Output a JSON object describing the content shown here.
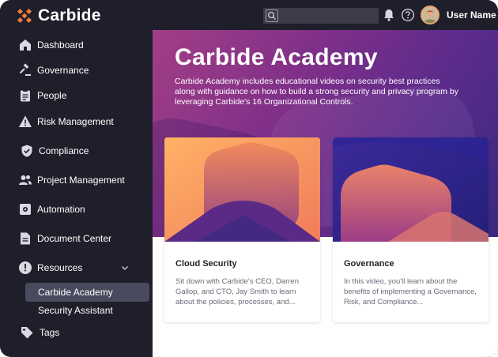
{
  "app": {
    "name": "Carbide",
    "brand_color": "#f07c3a",
    "sidebar_bg": "#1f1f2b"
  },
  "header": {
    "search_placeholder": "",
    "icons": [
      "search-icon",
      "bell-icon",
      "help-icon"
    ],
    "user_name": "User Name"
  },
  "sidebar": {
    "items": [
      {
        "label": "Dashboard",
        "icon": "home-icon"
      },
      {
        "label": "Governance",
        "icon": "gavel-icon"
      },
      {
        "label": "People",
        "icon": "clipboard-icon"
      },
      {
        "label": "Risk Management",
        "icon": "warning-icon"
      },
      {
        "label": "Compliance",
        "icon": "shield-check-icon"
      },
      {
        "label": "Project Management",
        "icon": "people-icon"
      },
      {
        "label": "Automation",
        "icon": "gear-box-icon"
      },
      {
        "label": "Document Center",
        "icon": "document-icon"
      },
      {
        "label": "Resources",
        "icon": "info-icon"
      },
      {
        "label": "Tags",
        "icon": "tag-icon"
      }
    ],
    "resources_sub": [
      {
        "label": "Carbide Academy",
        "active": true
      },
      {
        "label": "Security Assistant",
        "active": false
      }
    ]
  },
  "hero": {
    "title": "Carbide Academy",
    "description": "Carbide Academy includes educational videos on security best practices along with guidance on how to build a strong security and privacy program by leveraging Carbide's 16 Organizational Controls."
  },
  "cards": [
    {
      "title": "Cloud Security",
      "description": "Sit down with Carbide's CEO, Darren Gallop, and CTO, Jay Smith to learn about the policies, processes, and..."
    },
    {
      "title": "Governance",
      "description": "In this video, you'll learn about the benefits of implementing a Governance, Risk, and Compliance..."
    }
  ]
}
